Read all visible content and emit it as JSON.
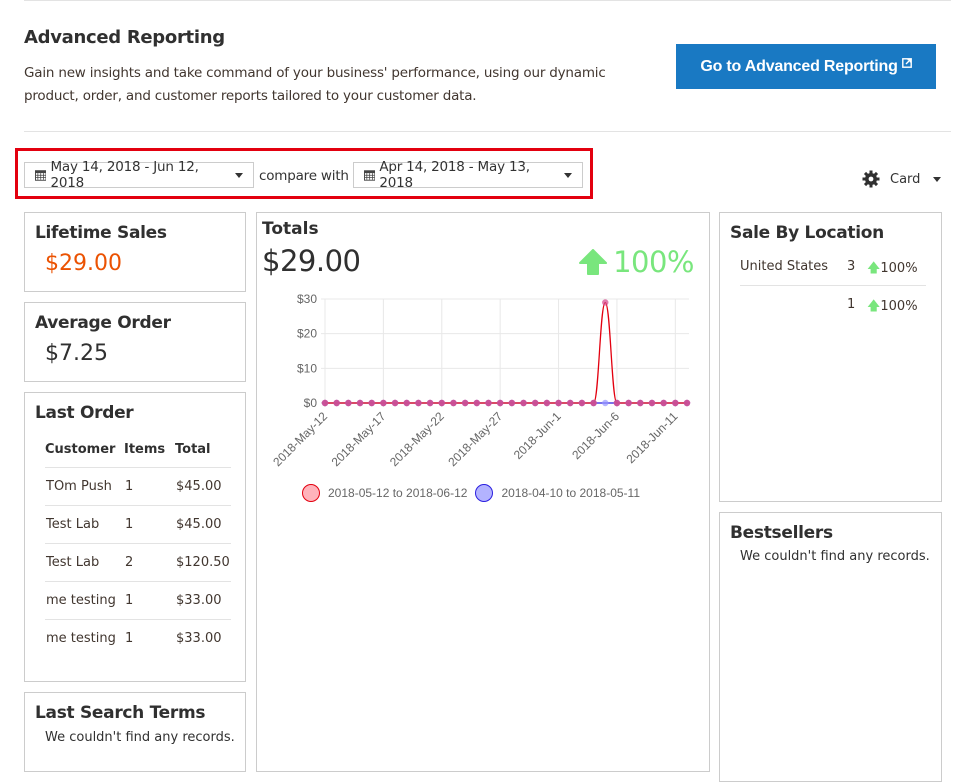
{
  "header": {
    "title": "Advanced Reporting",
    "description": "Gain new insights and take command of your business' performance, using our dynamic product, order, and customer reports tailored to your customer data.",
    "go_button": "Go to Advanced Reporting",
    "go_button_icon": "external-link-icon"
  },
  "filters": {
    "date_range": "May 14, 2018 - Jun 12, 2018",
    "compare_label": "compare with",
    "compare_range": "Apr 14, 2018 - May 13, 2018",
    "calendar_icon": "calendar-icon",
    "view_mode": "Card",
    "view_icon": "gear-icon"
  },
  "lifetime_sales": {
    "title": "Lifetime Sales",
    "value": "$29.00",
    "color": "#eb5202"
  },
  "average_order": {
    "title": "Average Order",
    "value": "$7.25"
  },
  "last_order": {
    "title": "Last Order",
    "columns": [
      "Customer",
      "Items",
      "Total"
    ],
    "rows": [
      [
        "TOm Push",
        "1",
        "$45.00"
      ],
      [
        "Test Lab",
        "1",
        "$45.00"
      ],
      [
        "Test Lab",
        "2",
        "$120.50"
      ],
      [
        "me testing",
        "1",
        "$33.00"
      ],
      [
        "me testing",
        "1",
        "$33.00"
      ]
    ]
  },
  "last_search_terms": {
    "title": "Last Search Terms",
    "empty": "We couldn't find any records."
  },
  "totals": {
    "title": "Totals",
    "value": "$29.00",
    "change": "100%",
    "change_direction": "up",
    "change_color": "#79e67d"
  },
  "sale_by_location": {
    "title": "Sale By Location",
    "rows": [
      {
        "country": "United States",
        "count": "3",
        "change": "100%"
      },
      {
        "country": "",
        "count": "1",
        "change": "100%"
      }
    ]
  },
  "bestsellers": {
    "title": "Bestsellers",
    "empty": "We couldn't find any records."
  },
  "chart_data": {
    "type": "line",
    "title": "",
    "xlabel": "",
    "ylabel": "",
    "ylim": [
      0,
      30
    ],
    "y_ticks": [
      "$0",
      "$10",
      "$20",
      "$30"
    ],
    "y_tick_values": [
      0,
      10,
      20,
      30
    ],
    "x": [
      "2018-May-12",
      "2018-May-13",
      "2018-May-14",
      "2018-May-15",
      "2018-May-16",
      "2018-May-17",
      "2018-May-18",
      "2018-May-19",
      "2018-May-20",
      "2018-May-21",
      "2018-May-22",
      "2018-May-23",
      "2018-May-24",
      "2018-May-25",
      "2018-May-26",
      "2018-May-27",
      "2018-May-28",
      "2018-May-29",
      "2018-May-30",
      "2018-May-31",
      "2018-Jun-1",
      "2018-Jun-2",
      "2018-Jun-3",
      "2018-Jun-4",
      "2018-Jun-5",
      "2018-Jun-6",
      "2018-Jun-7",
      "2018-Jun-8",
      "2018-Jun-9",
      "2018-Jun-10",
      "2018-Jun-11",
      "2018-Jun-12"
    ],
    "x_tick_labels": [
      "2018-May-12",
      "2018-May-17",
      "2018-May-22",
      "2018-May-27",
      "2018-Jun-1",
      "2018-Jun-6",
      "2018-Jun-11"
    ],
    "x_tick_indices": [
      0,
      5,
      10,
      15,
      20,
      25,
      30
    ],
    "grid": true,
    "legend_position": "bottom",
    "series": [
      {
        "name": "2018-05-12 to 2018-06-12",
        "color": "#e3000f",
        "fill": "#ffb3bb",
        "values": [
          0,
          0,
          0,
          0,
          0,
          0,
          0,
          0,
          0,
          0,
          0,
          0,
          0,
          0,
          0,
          0,
          0,
          0,
          0,
          0,
          0,
          0,
          0,
          0,
          29,
          0,
          0,
          0,
          0,
          0,
          0,
          0
        ]
      },
      {
        "name": "2018-04-10 to 2018-05-11",
        "color": "#2b1fe0",
        "fill": "#b3b3ff",
        "values": [
          0,
          0,
          0,
          0,
          0,
          0,
          0,
          0,
          0,
          0,
          0,
          0,
          0,
          0,
          0,
          0,
          0,
          0,
          0,
          0,
          0,
          0,
          0,
          0,
          0,
          0,
          0,
          0,
          0,
          0,
          0,
          0
        ]
      }
    ]
  }
}
